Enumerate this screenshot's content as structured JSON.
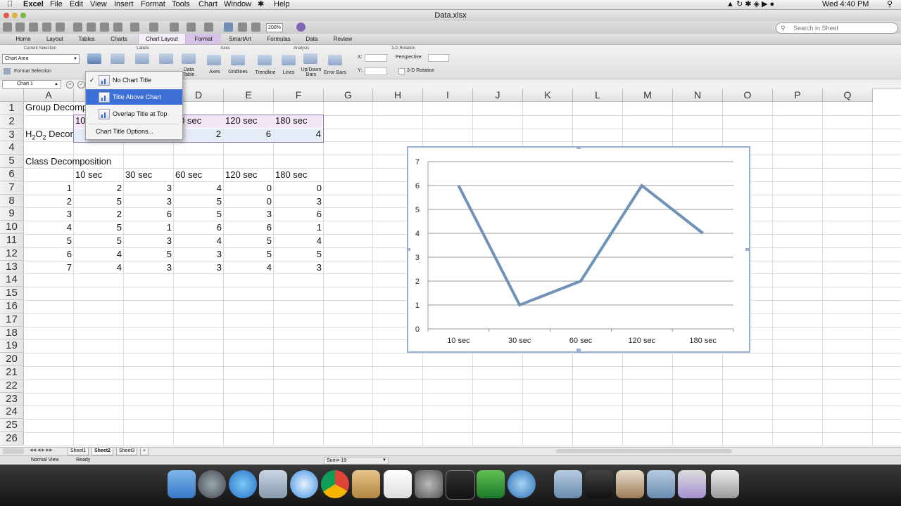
{
  "menubar": {
    "apple": "",
    "app": "Excel",
    "items": [
      "File",
      "Edit",
      "View",
      "Insert",
      "Format",
      "Tools",
      "Chart",
      "Window",
      "Help"
    ],
    "clock": "Wed 4:40 PM"
  },
  "window": {
    "title": "Data.xlsx",
    "zoom": "200%",
    "search_placeholder": "Search in Sheet"
  },
  "ribbon": {
    "tabs": [
      "Home",
      "Layout",
      "Tables",
      "Charts",
      "Chart Layout",
      "Format",
      "SmartArt",
      "Formulas",
      "Data",
      "Review"
    ],
    "groups": {
      "current_selection": "Current Selection",
      "labels": "Labels",
      "axes": "Axes",
      "analysis": "Analysis",
      "rotation": "3-D Rotation"
    },
    "selection_value": "Chart Area",
    "format_selection": "Format Selection",
    "buttons": {
      "data_table": "Data Table",
      "axes": "Axes",
      "gridlines": "Gridlines",
      "trendline": "Trendline",
      "lines": "Lines",
      "updown": "Up/Down Bars",
      "errorbars": "Error Bars"
    },
    "rotation": {
      "x": "X:",
      "y": "Y:",
      "perspective": "Perspective:",
      "three_d": "3-D Rotation"
    }
  },
  "namebox": "Chart 1",
  "columns": [
    "A",
    "B",
    "C",
    "D",
    "E",
    "F",
    "G",
    "H",
    "I",
    "J",
    "K",
    "L",
    "M",
    "N",
    "O",
    "P",
    "Q"
  ],
  "rows": [
    "1",
    "2",
    "3",
    "4",
    "5",
    "6",
    "7",
    "8",
    "9",
    "10",
    "11",
    "12",
    "13",
    "14",
    "15",
    "16",
    "17",
    "18",
    "19",
    "20",
    "21",
    "22",
    "23",
    "24",
    "25",
    "26"
  ],
  "cells": {
    "a1": "Group Decomp",
    "a3_main": "H",
    "a3_sub1": "2",
    "a3_o": "O",
    "a3_sub2": "2",
    "a3_rest": " Decor",
    "b2": "10",
    "d2": "0 sec",
    "e2": "120 sec",
    "f2": "180 sec",
    "d3": "2",
    "e3": "6",
    "f3": "4",
    "a5": "Class Decomposition",
    "headers6": [
      "10 sec",
      "30 sec",
      "60 sec",
      "120 sec",
      "180 sec"
    ],
    "table": [
      [
        "1",
        "2",
        "3",
        "4",
        "0",
        "0"
      ],
      [
        "2",
        "5",
        "3",
        "5",
        "0",
        "3"
      ],
      [
        "3",
        "2",
        "6",
        "5",
        "3",
        "6"
      ],
      [
        "4",
        "5",
        "1",
        "6",
        "6",
        "1"
      ],
      [
        "5",
        "5",
        "3",
        "4",
        "5",
        "4"
      ],
      [
        "6",
        "4",
        "5",
        "3",
        "5",
        "5"
      ],
      [
        "7",
        "4",
        "3",
        "3",
        "4",
        "3"
      ]
    ]
  },
  "dropdown": {
    "items": [
      "No Chart Title",
      "Title Above Chart",
      "Overlap Title at Top"
    ],
    "options": "Chart Title Options...",
    "checked": "✓"
  },
  "chart_data": {
    "type": "line",
    "categories": [
      "10 sec",
      "30 sec",
      "60 sec",
      "120 sec",
      "180 sec"
    ],
    "series": [
      {
        "values": [
          6,
          1,
          2,
          6,
          4
        ],
        "color": "#6f93b8"
      }
    ],
    "ylim": [
      0,
      7
    ],
    "yticks": [
      "0",
      "1",
      "2",
      "3",
      "4",
      "5",
      "6",
      "7"
    ],
    "grid": true
  },
  "sheets": [
    "Sheet1",
    "Sheet2",
    "Sheet3"
  ],
  "status": {
    "view": "Normal View",
    "ready": "Ready",
    "sum": "Sum= 19"
  }
}
